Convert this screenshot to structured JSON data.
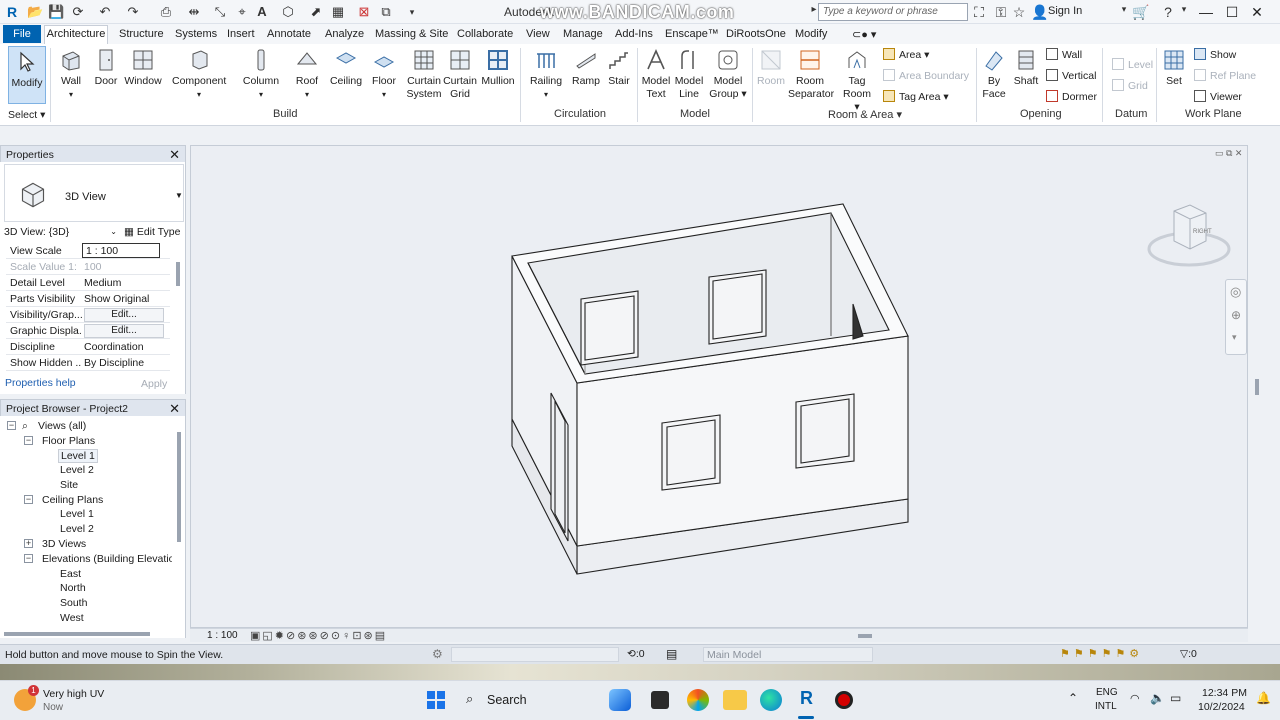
{
  "titlebar": {
    "app_title": "Autodesk",
    "watermark": "www.BANDICAM.com",
    "search_placeholder": "Type a keyword or phrase",
    "sign_in": "Sign In"
  },
  "tabs": [
    "File",
    "Architecture",
    "Structure",
    "Systems",
    "Insert",
    "Annotate",
    "Analyze",
    "Massing & Site",
    "Collaborate",
    "View",
    "Manage",
    "Add-Ins",
    "Enscape™",
    "DiRootsOne",
    "Modify"
  ],
  "ribbon": {
    "modify": "Modify",
    "select": "Select",
    "build": {
      "label": "Build",
      "wall": "Wall",
      "door": "Door",
      "window": "Window",
      "component": "Component",
      "column": "Column",
      "roof": "Roof",
      "ceiling": "Ceiling",
      "floor": "Floor",
      "curtain_system": "Curtain System",
      "curtain_grid": "Curtain Grid",
      "mullion": "Mullion"
    },
    "circulation": {
      "label": "Circulation",
      "railing": "Railing",
      "ramp": "Ramp",
      "stair": "Stair"
    },
    "model": {
      "label": "Model",
      "model_text": "Model Text",
      "model_line": "Model Line",
      "model_group": "Model Group"
    },
    "room_area": {
      "label": "Room & Area",
      "room": "Room",
      "room_separator": "Room Separator",
      "tag_room": "Tag Room",
      "area": "Area",
      "area_boundary": "Area Boundary",
      "tag_area": "Tag Area"
    },
    "opening": {
      "label": "Opening",
      "by_face": "By Face",
      "shaft": "Shaft",
      "wall": "Wall",
      "vertical": "Vertical",
      "dormer": "Dormer"
    },
    "datum": {
      "label": "Datum",
      "level": "Level",
      "grid": "Grid"
    },
    "work_plane": {
      "label": "Work Plane",
      "set": "Set",
      "show": "Show",
      "ref_plane": "Ref Plane",
      "viewer": "Viewer"
    }
  },
  "properties": {
    "title": "Properties",
    "type_name": "3D View",
    "instance": "3D View: {3D}",
    "edit_type": "Edit Type",
    "rows": [
      {
        "k": "View Scale",
        "v": "1 : 100"
      },
      {
        "k": "Scale Value    1:",
        "v": "100"
      },
      {
        "k": "Detail Level",
        "v": "Medium"
      },
      {
        "k": "Parts Visibility",
        "v": "Show Original"
      },
      {
        "k": "Visibility/Grap...",
        "v": "Edit..."
      },
      {
        "k": "Graphic Displa...",
        "v": "Edit..."
      },
      {
        "k": "Discipline",
        "v": "Coordination"
      },
      {
        "k": "Show Hidden ...",
        "v": "By Discipline"
      }
    ],
    "help": "Properties help",
    "apply": "Apply"
  },
  "browser": {
    "title": "Project Browser - Project2",
    "nodes": [
      "Views (all)",
      "Floor Plans",
      "Level 1",
      "Level 2",
      "Site",
      "Ceiling Plans",
      "Level 1",
      "Level 2",
      "3D Views",
      "Elevations (Building Elevatio",
      "East",
      "North",
      "South",
      "West"
    ]
  },
  "viewcube": {
    "face": "RIGHT"
  },
  "viewctl": {
    "scale": "1 : 100"
  },
  "status": {
    "hint": "Hold button and move mouse to Spin the View.",
    "zero1": ":0",
    "main_model": "Main Model",
    "zero2": ":0"
  },
  "taskbar": {
    "weather_title": "Very high UV",
    "weather_sub": "Now",
    "badge": "1",
    "search": "Search",
    "lang1": "ENG",
    "lang2": "INTL",
    "time": "12:34 PM",
    "date": "10/2/2024"
  },
  "colors": {
    "accent": "#0063b1",
    "modify_active": "#cfe3f7"
  }
}
